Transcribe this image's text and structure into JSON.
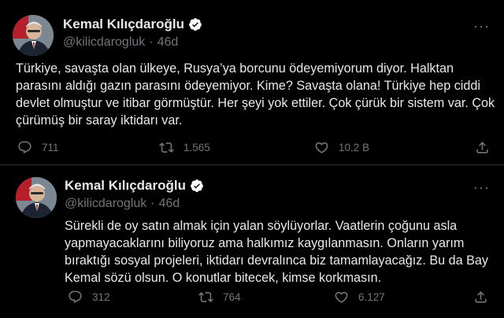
{
  "colors": {
    "background": "#000000",
    "text": "#e7e9ea",
    "muted": "#71767b",
    "verified": "#ffffff",
    "divider": "#2f3336"
  },
  "tweets": [
    {
      "author_name": "Kemal Kılıçdaroğlu",
      "handle": "@kilicdarogluk",
      "separator": "·",
      "age": "46d",
      "text": "Türkiye, savaşta olan ülkeye, Rusya’ya borcunu ödeyemiyorum diyor. Halktan parasını aldığı gazın parasını ödeyemiyor. Kime? Savaşta olana! Türkiye hep ciddi devlet olmuştur ve itibar görmüştür. Her şeyi yok ettiler. Çok çürük bir sistem var. Çok çürümüş bir saray iktidarı var.",
      "replies": "711",
      "retweets": "1.565",
      "likes": "10,2 B",
      "icons": [
        "reply-icon",
        "retweet-icon",
        "like-icon",
        "share-icon"
      ]
    },
    {
      "author_name": "Kemal Kılıçdaroğlu",
      "handle": "@kilicdarogluk",
      "separator": "·",
      "age": "46d",
      "text": "Sürekli de oy satın almak için yalan söylüyorlar. Vaatlerin çoğunu asla yapmayacaklarını biliyoruz ama halkımız kaygılanmasın. Onların yarım bıraktığı sosyal projeleri, iktidarı devralınca biz tamamlayacağız. Bu da Bay Kemal sözü olsun. O konutlar bitecek, kimse korkmasın.",
      "replies": "312",
      "retweets": "764",
      "likes": "6.127",
      "icons": [
        "reply-icon",
        "retweet-icon",
        "like-icon",
        "share-icon"
      ]
    }
  ]
}
